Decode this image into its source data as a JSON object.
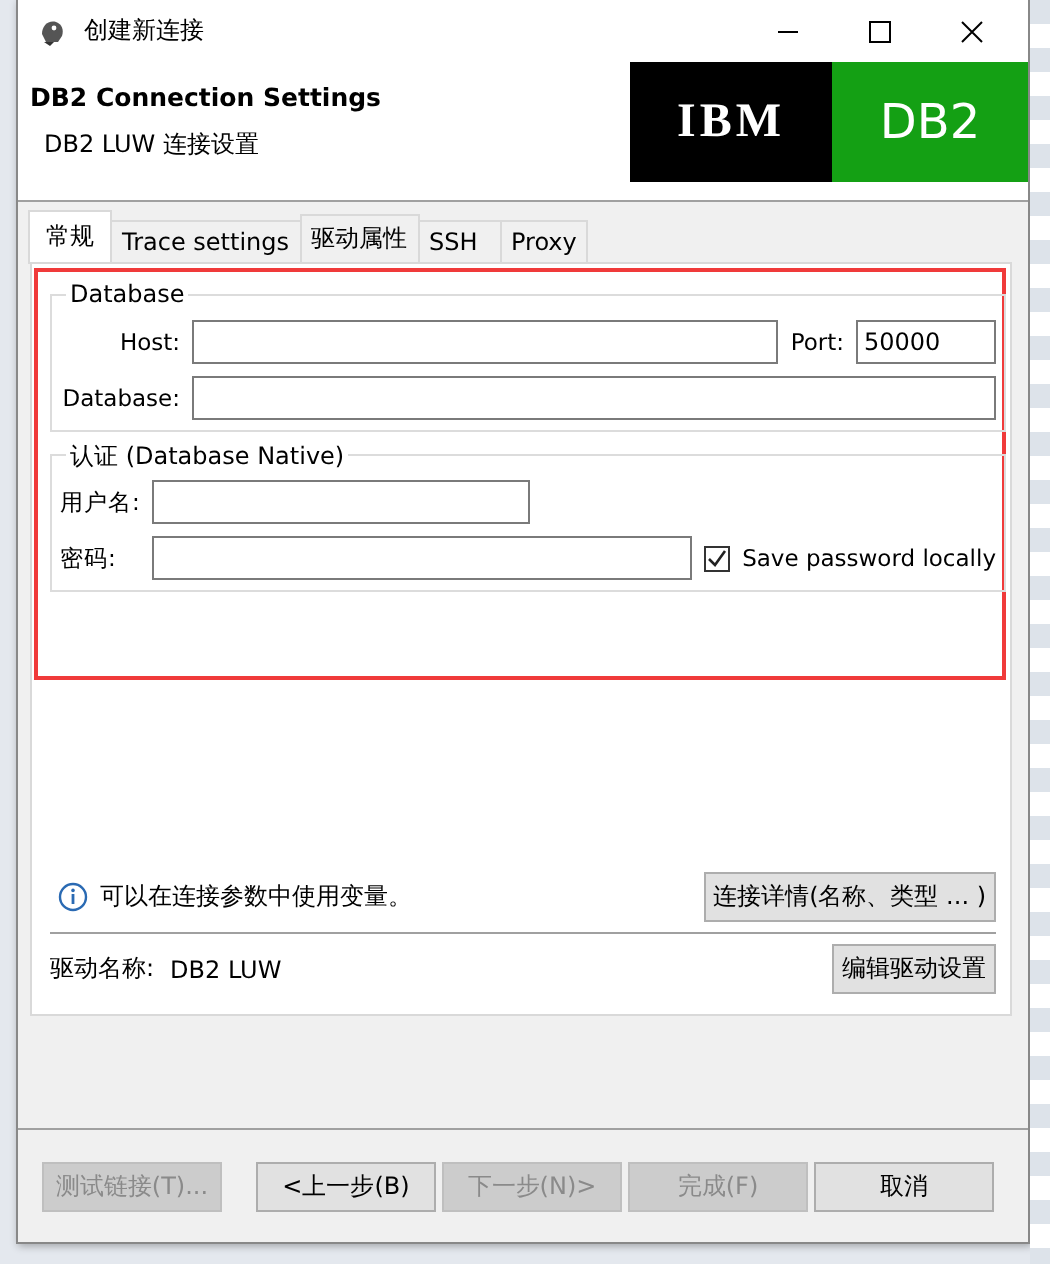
{
  "window": {
    "title": "创建新连接"
  },
  "header": {
    "title": "DB2 Connection Settings",
    "subtitle": "DB2 LUW 连接设置",
    "logo_left": "IBM",
    "logo_right": "DB2"
  },
  "tabs": [
    {
      "label": "常规",
      "selected": true
    },
    {
      "label": "Trace settings",
      "selected": false
    },
    {
      "label": "驱动属性",
      "selected": false
    },
    {
      "label": "SSH",
      "selected": false
    },
    {
      "label": "Proxy",
      "selected": false
    }
  ],
  "database_group": {
    "legend": "Database",
    "host_label": "Host:",
    "port_label": "Port:",
    "port_value": "50000",
    "database_label": "Database:"
  },
  "auth_group": {
    "legend": "认证 (Database Native)",
    "user_label": "用户名:",
    "password_label": "密码:",
    "save_password": {
      "label": "Save password locally",
      "checked": true
    }
  },
  "info": {
    "text": "可以在连接参数中使用变量。",
    "button": "连接详情(名称、类型 ... )"
  },
  "driver": {
    "label": "驱动名称:",
    "name": "DB2 LUW",
    "button": "编辑驱动设置"
  },
  "buttons": [
    {
      "label": "测试链接(T)...",
      "disabled": true
    },
    {
      "label": "<上一步(B)",
      "disabled": false
    },
    {
      "label": "下一步(N)>",
      "disabled": true
    },
    {
      "label": "完成(F)",
      "disabled": true
    },
    {
      "label": "取消",
      "disabled": false
    }
  ]
}
